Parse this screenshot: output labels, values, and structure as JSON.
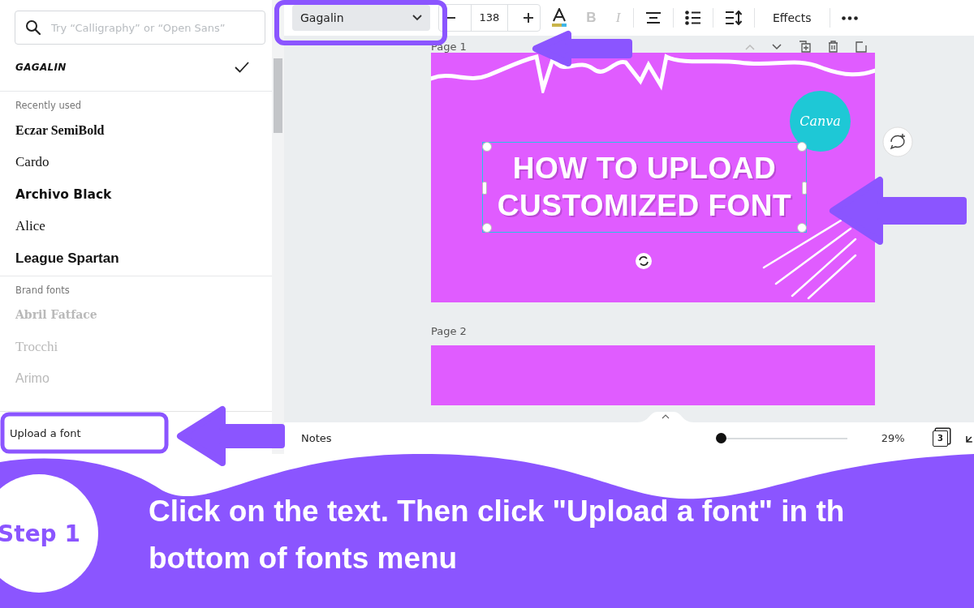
{
  "font_panel": {
    "search": {
      "placeholder": "Try “Calligraphy” or “Open Sans”"
    },
    "current_font": {
      "label": "GAGALIN",
      "kind": "display",
      "selected": true,
      "disabled": false
    },
    "groups": [
      {
        "heading": "Recently used",
        "fonts": [
          {
            "label": "Eczar SemiBold",
            "kind": "serif-bold",
            "selected": false,
            "disabled": false
          },
          {
            "label": "Cardo",
            "kind": "serif",
            "selected": false,
            "disabled": false
          },
          {
            "label": "Archivo Black",
            "kind": "sans-black",
            "selected": false,
            "disabled": false
          },
          {
            "label": "Alice",
            "kind": "serif",
            "selected": false,
            "disabled": false
          },
          {
            "label": "League Spartan",
            "kind": "sans-bold",
            "selected": false,
            "disabled": false
          }
        ]
      },
      {
        "heading": "Brand fonts",
        "fonts": [
          {
            "label": "Abril Fatface",
            "kind": "serif-heavy",
            "selected": false,
            "disabled": true
          },
          {
            "label": "Trocchi",
            "kind": "serif",
            "selected": false,
            "disabled": true
          },
          {
            "label": "Arimo",
            "kind": "sans",
            "selected": false,
            "disabled": true
          }
        ]
      }
    ],
    "upload_button": "Upload a font"
  },
  "toolbar": {
    "font_dropdown": "Gagalin",
    "font_size": "138",
    "format_buttons": [
      {
        "glyph": "B",
        "kind": "bold",
        "disabled": true
      },
      {
        "glyph": "I",
        "kind": "italic",
        "disabled": true
      }
    ],
    "effects_button": "Effects"
  },
  "pages": [
    {
      "label": "Page 1",
      "kind": "title"
    },
    {
      "label": "Page 2",
      "kind": "blank"
    }
  ],
  "design": {
    "title_lines": [
      "HOW TO UPLOAD",
      "CUSTOMIZED FONT"
    ],
    "logo": "Canva"
  },
  "bottom_bar": {
    "notes": "Notes",
    "zoom": {
      "level": 0,
      "reading": "29%"
    },
    "page_count": "3"
  },
  "banner": {
    "step": "Step 1",
    "instruction_lines": [
      "Click on the text. Then click \"Upload a font\" in th",
      "bottom of fonts menu"
    ]
  }
}
